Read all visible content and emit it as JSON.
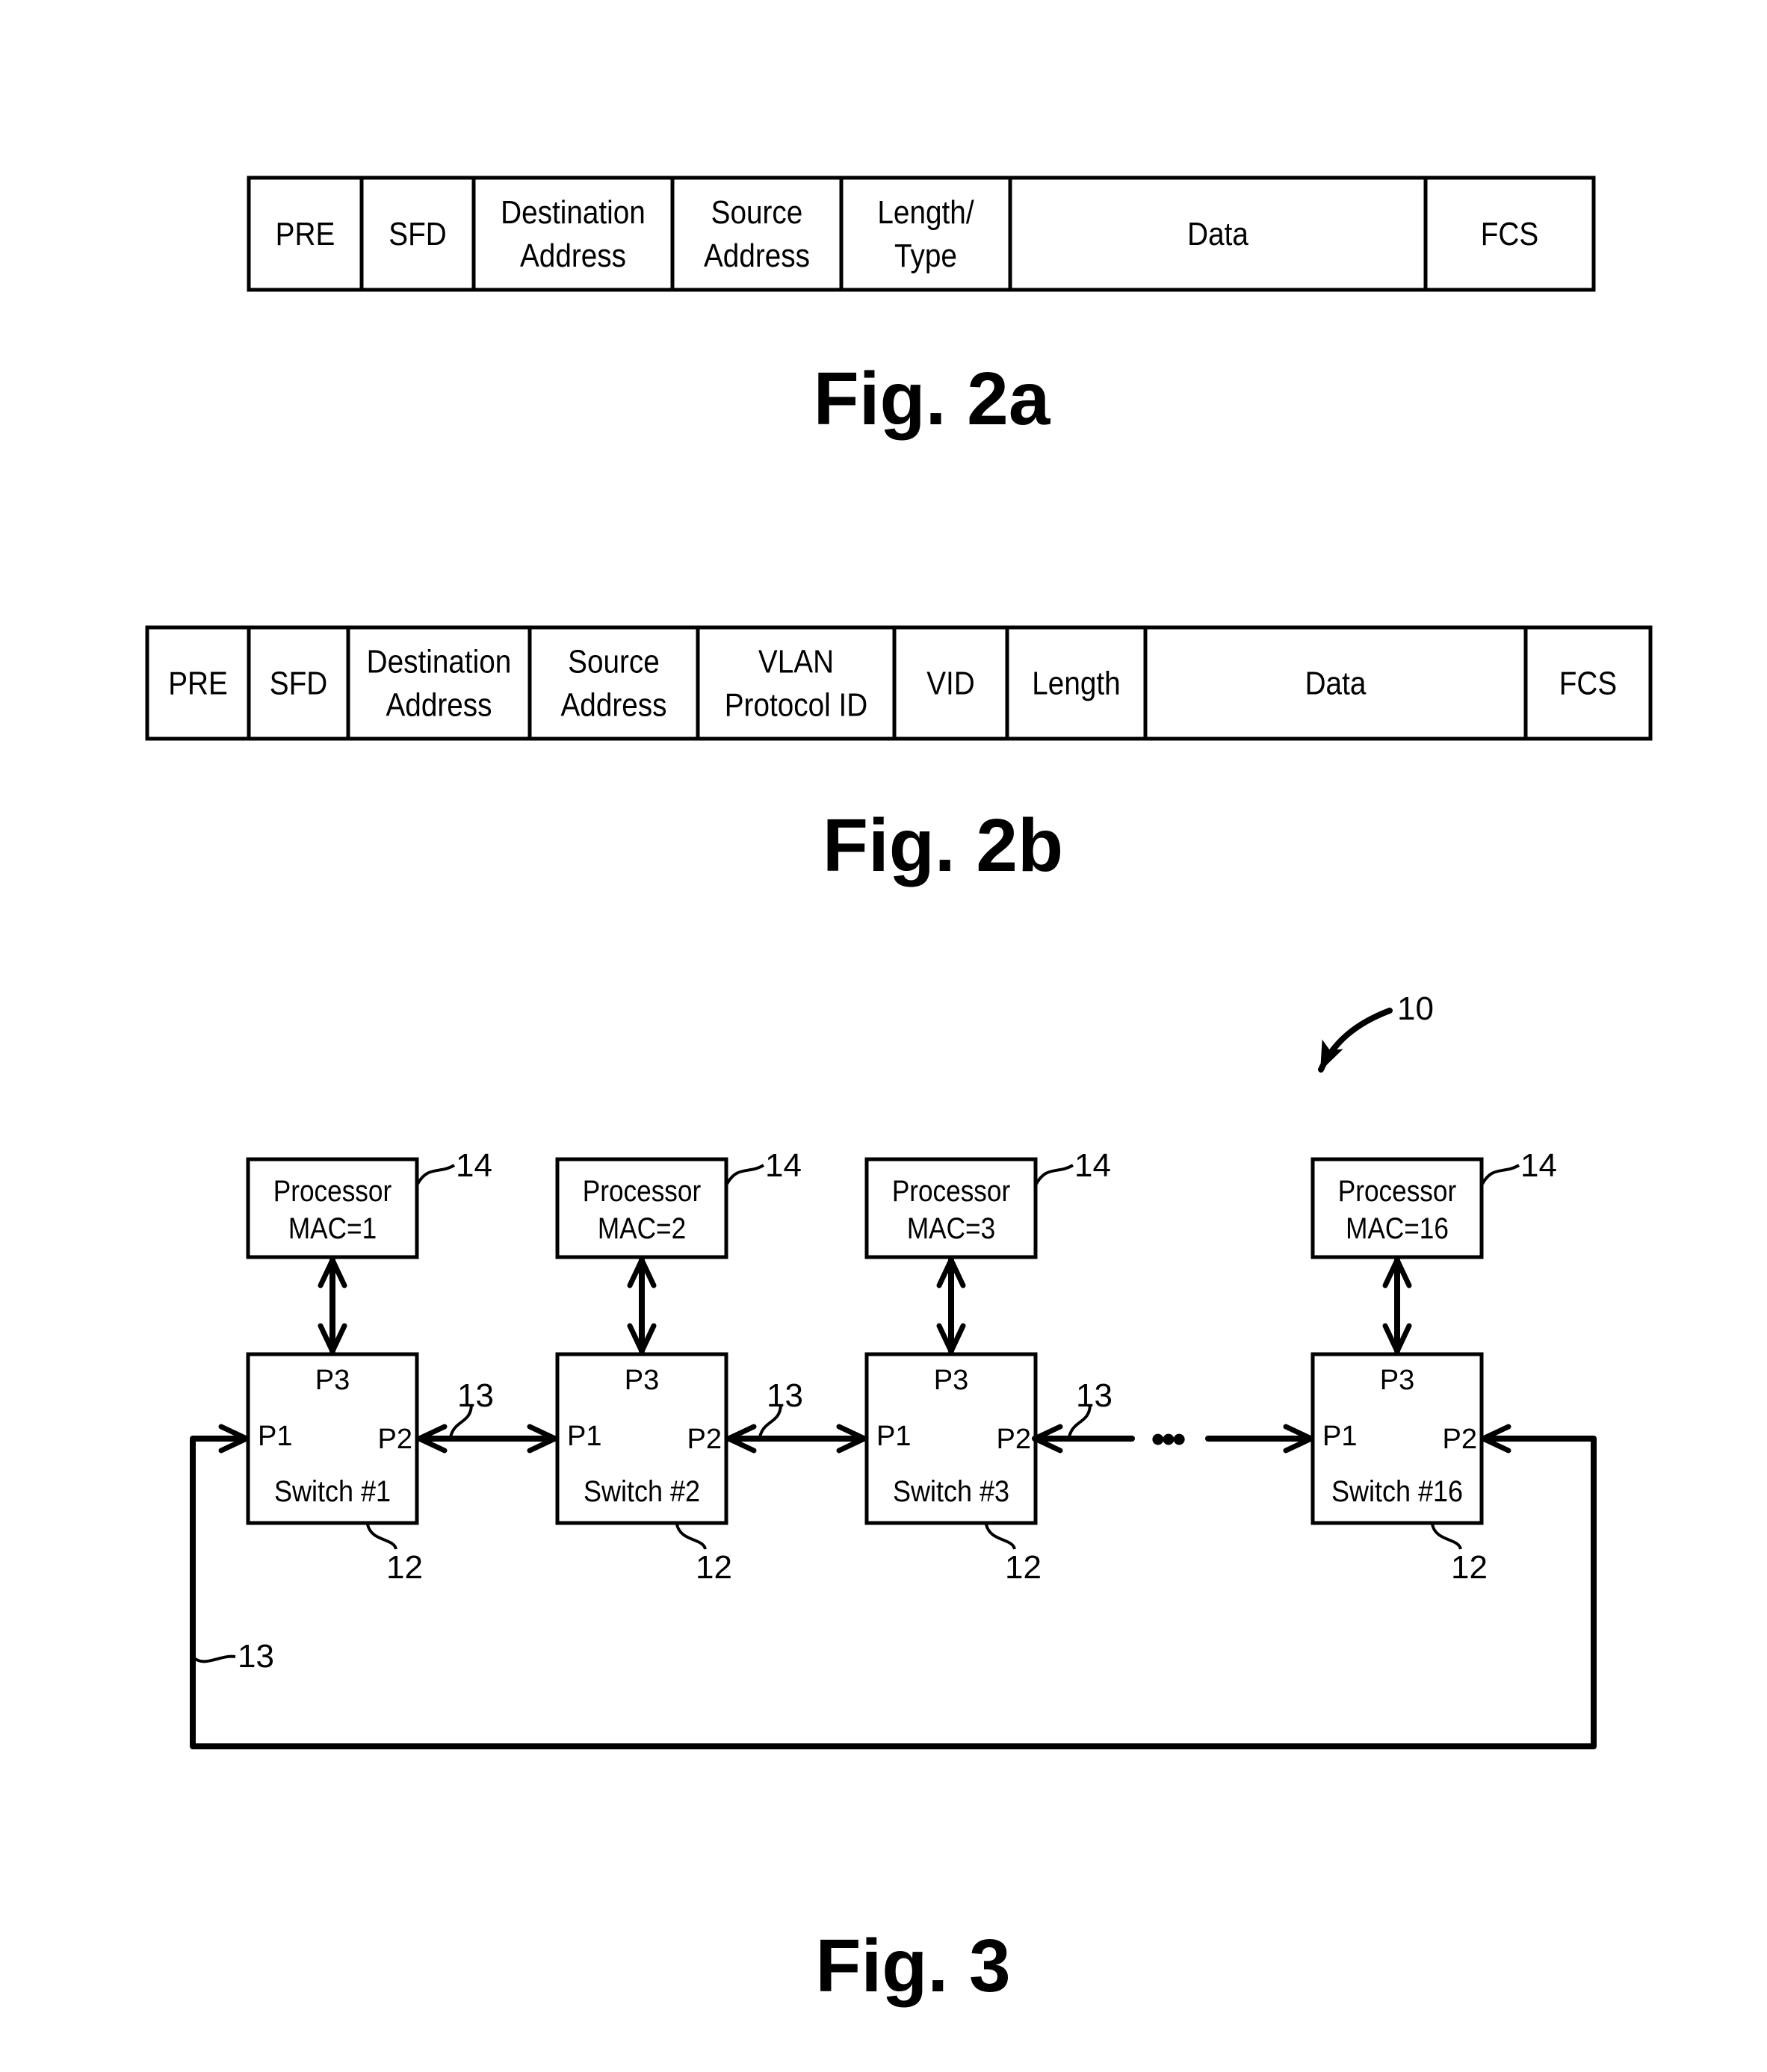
{
  "fig2a": {
    "caption": "Fig. 2a",
    "fields": [
      {
        "lines": [
          "PRE"
        ]
      },
      {
        "lines": [
          "SFD"
        ]
      },
      {
        "lines": [
          "Destination",
          "Address"
        ]
      },
      {
        "lines": [
          "Source",
          "Address"
        ]
      },
      {
        "lines": [
          "Length/",
          "Type"
        ]
      },
      {
        "lines": [
          "Data"
        ]
      },
      {
        "lines": [
          "FCS"
        ]
      }
    ]
  },
  "fig2b": {
    "caption": "Fig. 2b",
    "fields": [
      {
        "lines": [
          "PRE"
        ]
      },
      {
        "lines": [
          "SFD"
        ]
      },
      {
        "lines": [
          "Destination",
          "Address"
        ]
      },
      {
        "lines": [
          "Source",
          "Address"
        ]
      },
      {
        "lines": [
          "VLAN",
          "Protocol ID"
        ]
      },
      {
        "lines": [
          "VID"
        ]
      },
      {
        "lines": [
          "Length"
        ]
      },
      {
        "lines": [
          "Data"
        ]
      },
      {
        "lines": [
          "FCS"
        ]
      }
    ]
  },
  "fig3": {
    "caption": "Fig. 3",
    "system_ref": "10",
    "link_ref": "13",
    "nodes": [
      {
        "processor": [
          "Processor",
          "MAC=1"
        ],
        "processor_ref": "14",
        "switch": "Switch #1",
        "switch_ref": "12",
        "ports": [
          "P1",
          "P2",
          "P3"
        ],
        "link_ref": "13"
      },
      {
        "processor": [
          "Processor",
          "MAC=2"
        ],
        "processor_ref": "14",
        "switch": "Switch #2",
        "switch_ref": "12",
        "ports": [
          "P1",
          "P2",
          "P3"
        ],
        "link_ref": "13"
      },
      {
        "processor": [
          "Processor",
          "MAC=3"
        ],
        "processor_ref": "14",
        "switch": "Switch #3",
        "switch_ref": "12",
        "ports": [
          "P1",
          "P2",
          "P3"
        ],
        "link_ref": "13"
      },
      {
        "processor": [
          "Processor",
          "MAC=16"
        ],
        "processor_ref": "14",
        "switch": "Switch #16",
        "switch_ref": "12",
        "ports": [
          "P1",
          "P2",
          "P3"
        ],
        "link_ref": ""
      }
    ],
    "ellipsis": "•••"
  }
}
